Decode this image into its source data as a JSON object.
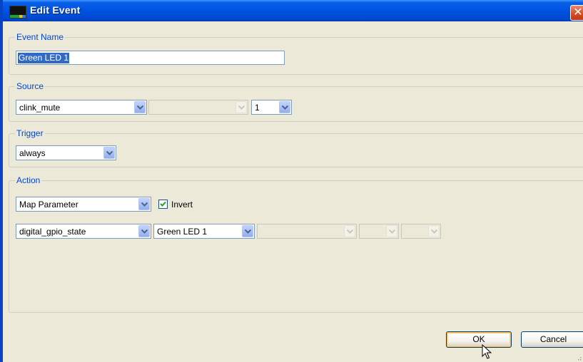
{
  "window": {
    "title": "Edit Event",
    "close_glyph": "✕"
  },
  "event_name": {
    "legend": "Event Name",
    "value": "Green LED 1"
  },
  "source": {
    "legend": "Source",
    "combo1": "clink_mute",
    "combo2": "",
    "combo3": "1"
  },
  "trigger": {
    "legend": "Trigger",
    "combo": "always"
  },
  "action": {
    "legend": "Action",
    "mode": "Map Parameter",
    "invert_label": "Invert",
    "invert_checked": true,
    "param1": "digital_gpio_state",
    "param2": "Green LED 1",
    "param3": "",
    "param4": "",
    "param5": ""
  },
  "buttons": {
    "ok": "OK",
    "cancel": "Cancel"
  },
  "colors": {
    "title_bar": "#0054E3",
    "legend_text": "#0046D5",
    "dialog_bg": "#ECE9D8",
    "selection": "#316AC5"
  },
  "icons": [
    "app-icon",
    "close-icon",
    "chevron-down-icon",
    "checkmark-icon",
    "mouse-cursor-icon",
    "resize-grip-icon"
  ]
}
